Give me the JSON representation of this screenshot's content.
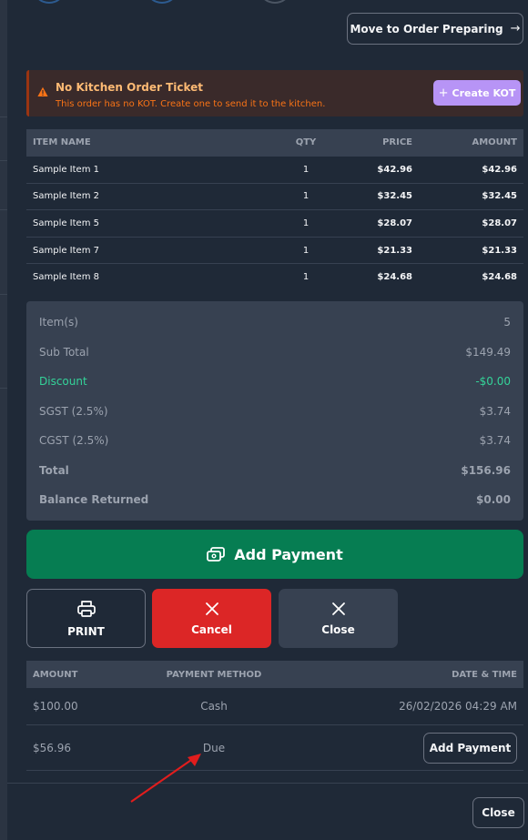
{
  "header": {
    "move_button_label": "Move to Order Preparing"
  },
  "alert": {
    "title": "No Kitchen Order Ticket",
    "message": "This order has no KOT. Create one to send it to the kitchen.",
    "create_kot_label": "Create KOT",
    "color": "#f97316"
  },
  "items_table": {
    "headers": {
      "name": "ITEM NAME",
      "qty": "QTY",
      "price": "PRICE",
      "amount": "AMOUNT"
    },
    "rows": [
      {
        "name": "Sample Item 1",
        "qty": "1",
        "price": "$42.96",
        "amount": "$42.96"
      },
      {
        "name": "Sample Item 2",
        "qty": "1",
        "price": "$32.45",
        "amount": "$32.45"
      },
      {
        "name": "Sample Item 5",
        "qty": "1",
        "price": "$28.07",
        "amount": "$28.07"
      },
      {
        "name": "Sample Item 7",
        "qty": "1",
        "price": "$21.33",
        "amount": "$21.33"
      },
      {
        "name": "Sample Item 8",
        "qty": "1",
        "price": "$24.68",
        "amount": "$24.68"
      }
    ]
  },
  "summary": {
    "items_label": "Item(s)",
    "items_value": "5",
    "subtotal_label": "Sub Total",
    "subtotal_value": "$149.49",
    "discount_label": "Discount",
    "discount_value": "-$0.00",
    "sgst_label": "SGST (2.5%)",
    "sgst_value": "$3.74",
    "cgst_label": "CGST (2.5%)",
    "cgst_value": "$3.74",
    "total_label": "Total",
    "total_value": "$156.96",
    "balance_label": "Balance Returned",
    "balance_value": "$0.00"
  },
  "actions": {
    "add_payment_label": "Add Payment",
    "print_label": "PRINT",
    "cancel_label": "Cancel",
    "close_label": "Close"
  },
  "payments_table": {
    "headers": {
      "amount": "AMOUNT",
      "method": "PAYMENT METHOD",
      "date": "DATE & TIME"
    },
    "rows": [
      {
        "amount": "$100.00",
        "method": "Cash",
        "date": "26/02/2026 04:29 AM"
      },
      {
        "amount": "$56.96",
        "method": "Due",
        "action_label": "Add Payment"
      }
    ]
  },
  "footer": {
    "close_label": "Close"
  },
  "colors": {
    "accent_green": "#067d52",
    "danger_red": "#dc2626",
    "kot_purple": "#b794f6",
    "discount_green": "#34d399",
    "annotation_arrow": "#e11d1d"
  },
  "icons": {
    "move": "arrow-right-icon",
    "alert": "warning-triangle-icon",
    "kot": "plus-icon",
    "add_payment": "payment-cards-icon",
    "print": "printer-icon",
    "cancel": "x-icon",
    "close": "x-icon"
  }
}
